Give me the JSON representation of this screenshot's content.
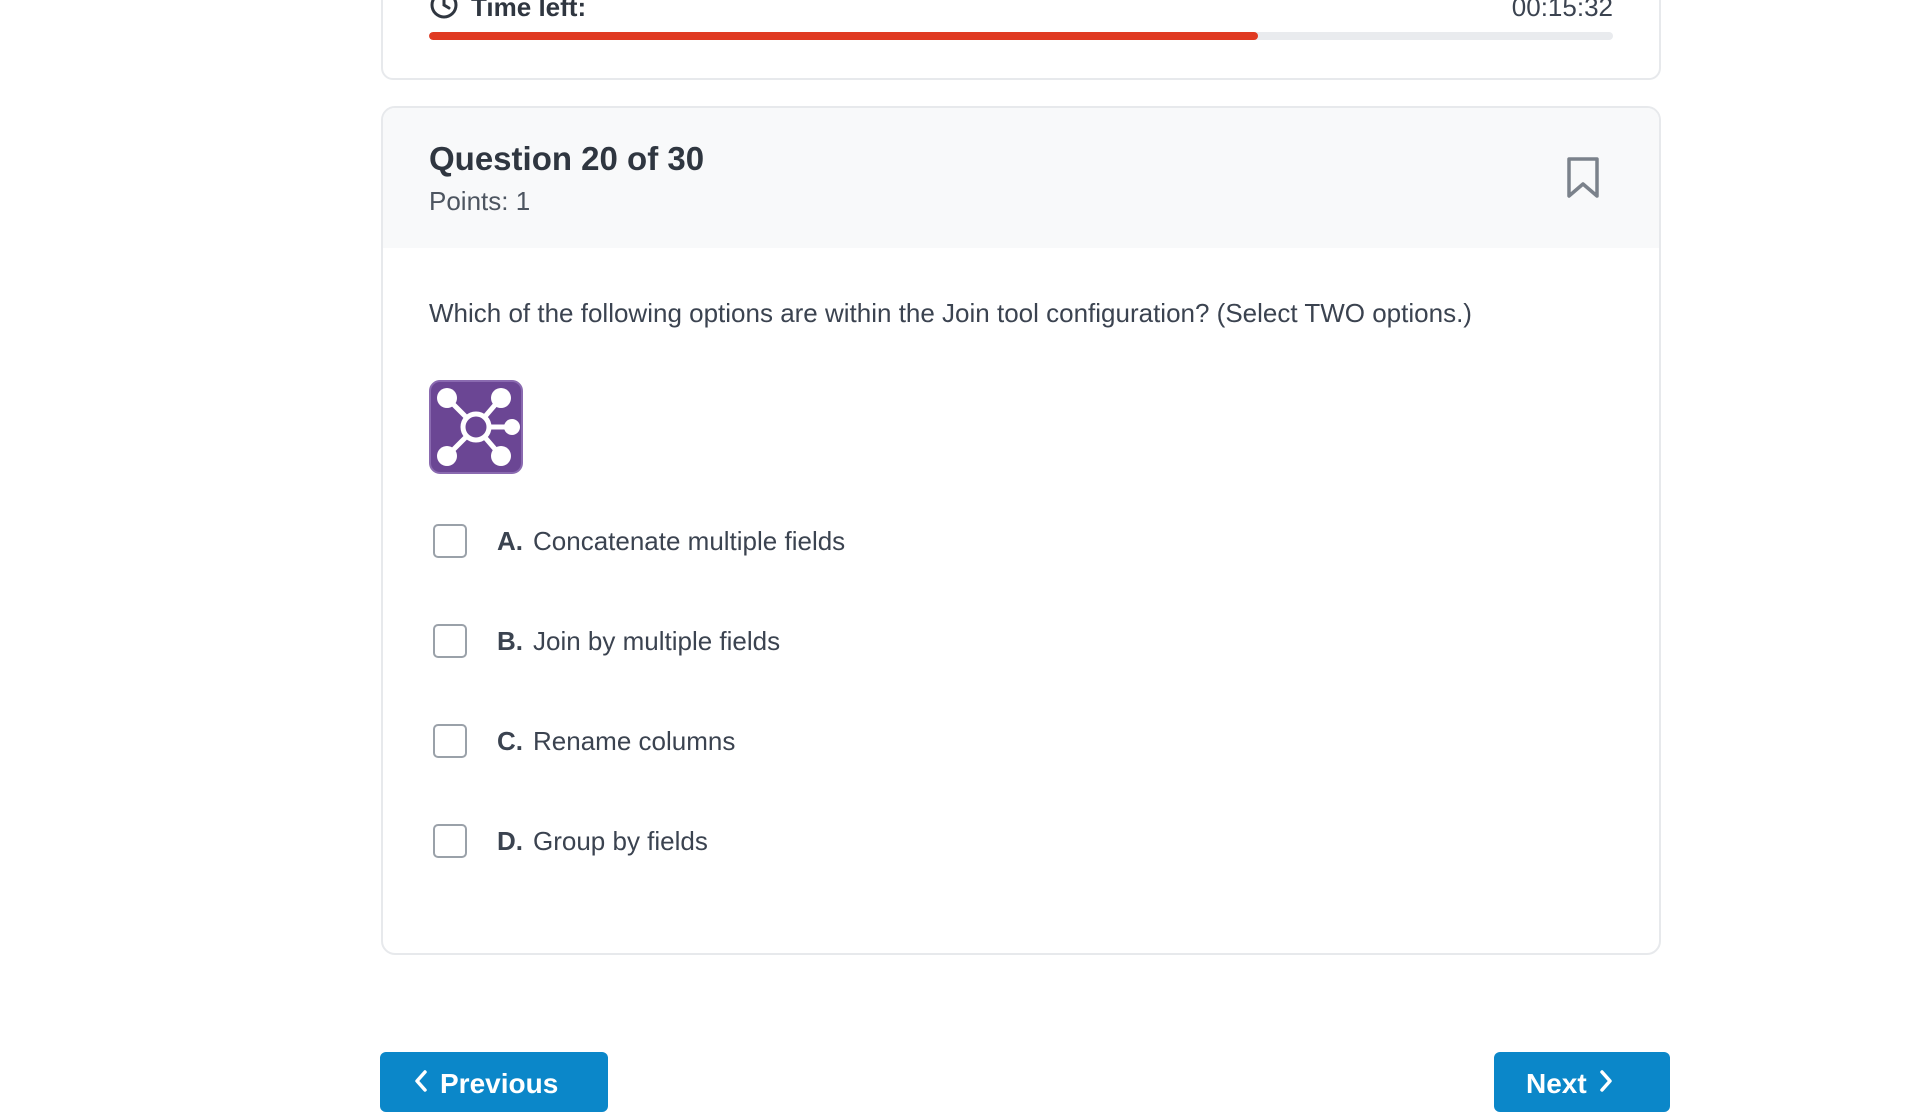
{
  "timer": {
    "label": "Time left:",
    "value": "00:15:32",
    "icon": "clock-icon",
    "progress_fraction": 0.7,
    "progress_color": "#e03a22"
  },
  "question": {
    "title": "Question 20 of 30",
    "points": "Points: 1",
    "text": "Which of the following options are within the Join tool configuration? (Select TWO options.)",
    "bookmark_icon": "bookmark-icon",
    "image_icon": "join-tool-icon",
    "image_color": "#6b4694",
    "options": [
      {
        "letter": "A.",
        "text": "Concatenate multiple fields"
      },
      {
        "letter": "B.",
        "text": "Join by multiple fields"
      },
      {
        "letter": "C.",
        "text": "Rename columns"
      },
      {
        "letter": "D.",
        "text": "Group by fields"
      }
    ]
  },
  "navigation": {
    "previous_label": "Previous",
    "next_label": "Next",
    "button_color": "#0b87c9"
  }
}
